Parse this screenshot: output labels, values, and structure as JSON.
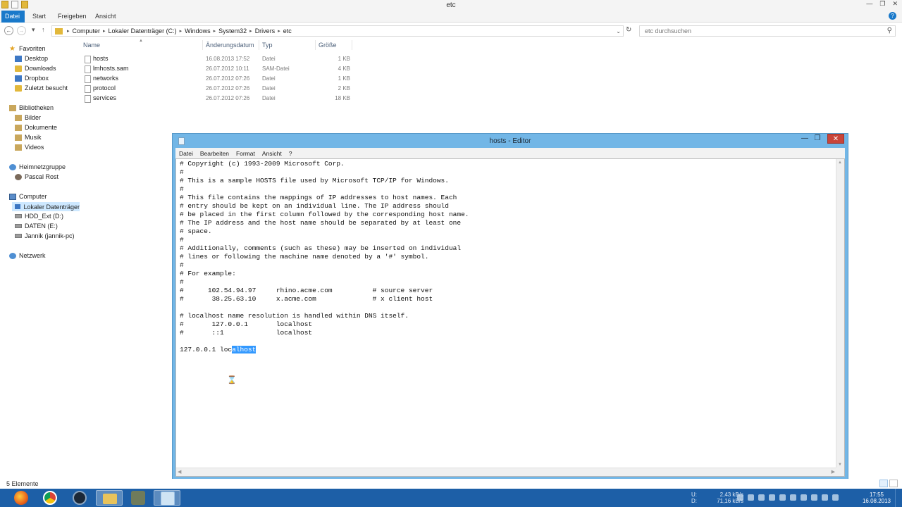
{
  "explorer": {
    "window_title": "etc",
    "ribbon_tabs": [
      "Datei",
      "Start",
      "Freigeben",
      "Ansicht"
    ],
    "breadcrumb": [
      "Computer",
      "Lokaler Datenträger (C:)",
      "Windows",
      "System32",
      "Drivers",
      "etc"
    ],
    "search_placeholder": "etc durchsuchen",
    "columns": {
      "name": "Name",
      "date": "Änderungsdatum",
      "type": "Typ",
      "size": "Größe"
    },
    "files": [
      {
        "name": "hosts",
        "date": "16.08.2013 17:52",
        "type": "Datei",
        "size": "1 KB"
      },
      {
        "name": "lmhosts.sam",
        "date": "26.07.2012 10:11",
        "type": "SAM-Datei",
        "size": "4 KB"
      },
      {
        "name": "networks",
        "date": "26.07.2012 07:26",
        "type": "Datei",
        "size": "1 KB"
      },
      {
        "name": "protocol",
        "date": "26.07.2012 07:26",
        "type": "Datei",
        "size": "2 KB"
      },
      {
        "name": "services",
        "date": "26.07.2012 07:26",
        "type": "Datei",
        "size": "18 KB"
      }
    ],
    "status": "5 Elemente",
    "nav": {
      "favorites": "Favoriten",
      "fav_items": [
        "Desktop",
        "Downloads",
        "Dropbox",
        "Zuletzt besucht"
      ],
      "libraries": "Bibliotheken",
      "lib_items": [
        "Bilder",
        "Dokumente",
        "Musik",
        "Videos"
      ],
      "homegroup": "Heimnetzgruppe",
      "homegroup_items": [
        "Pascal Rost"
      ],
      "computer": "Computer",
      "computer_items": [
        "Lokaler Datenträger",
        "HDD_Ext (D:)",
        "DATEN (E:)",
        "Jannik (jannik-pc)"
      ],
      "network": "Netzwerk"
    }
  },
  "notepad": {
    "title": "hosts - Editor",
    "menu": [
      "Datei",
      "Bearbeiten",
      "Format",
      "Ansicht",
      "?"
    ],
    "lines": [
      "# Copyright (c) 1993-2009 Microsoft Corp.",
      "#",
      "# This is a sample HOSTS file used by Microsoft TCP/IP for Windows.",
      "#",
      "# This file contains the mappings of IP addresses to host names. Each",
      "# entry should be kept on an individual line. The IP address should",
      "# be placed in the first column followed by the corresponding host name.",
      "# The IP address and the host name should be separated by at least one",
      "# space.",
      "#",
      "# Additionally, comments (such as these) may be inserted on individual",
      "# lines or following the machine name denoted by a '#' symbol.",
      "#",
      "# For example:",
      "#",
      "#      102.54.94.97     rhino.acme.com          # source server",
      "#       38.25.63.10     x.acme.com              # x client host",
      "",
      "# localhost name resolution is handled within DNS itself.",
      "#       127.0.0.1       localhost",
      "#       ::1             localhost",
      ""
    ],
    "last_line_plain": "127.0.0.1 loc",
    "last_line_selected": "alhost"
  },
  "taskbar": {
    "net_labels": [
      "U:",
      "D:"
    ],
    "net_values": [
      "2,43 kB/s",
      "71,16 kB/s"
    ],
    "time": "17:55",
    "date": "16.08.2013",
    "apps": [
      "firefox",
      "chrome",
      "steam",
      "explorer",
      "tool",
      "notepad"
    ]
  }
}
